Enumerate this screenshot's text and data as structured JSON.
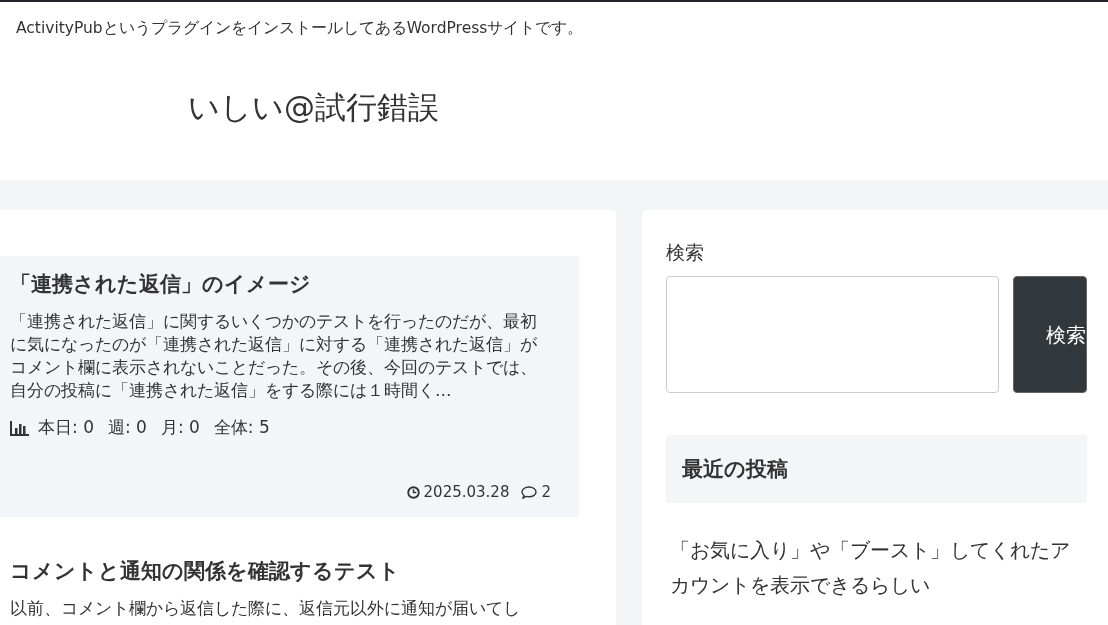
{
  "site": {
    "description": "ActivityPubというプラグインをインストールしてあるWordPressサイトです。",
    "title": "いしい@試行錯誤"
  },
  "posts": [
    {
      "title": "「連携された返信」のイメージ",
      "excerpt": "「連携された返信」に関するいくつかのテストを行ったのだが、最初に気になったのが「連携された返信」に対する「連携された返信」がコメント欄に表示されないことだった。その後、今回のテストでは、自分の投稿に「連携された返信」をする際には１時間く…",
      "stats": [
        {
          "label": "本日:",
          "value": "0"
        },
        {
          "label": "週:",
          "value": "0"
        },
        {
          "label": "月:",
          "value": "0"
        },
        {
          "label": "全体:",
          "value": "5"
        }
      ],
      "date": "2025.03.28",
      "comments": "2"
    },
    {
      "title": "コメントと通知の関係を確認するテスト",
      "excerpt": "以前、コメント欄から返信した際に、返信元以外に通知が届いてし"
    }
  ],
  "sidebar": {
    "search": {
      "label": "検索",
      "button": "検索"
    },
    "recent": {
      "heading": "最近の投稿",
      "items": [
        "「お気に入り」や「ブースト」してくれたアカウントを表示できるらしい"
      ]
    }
  }
}
